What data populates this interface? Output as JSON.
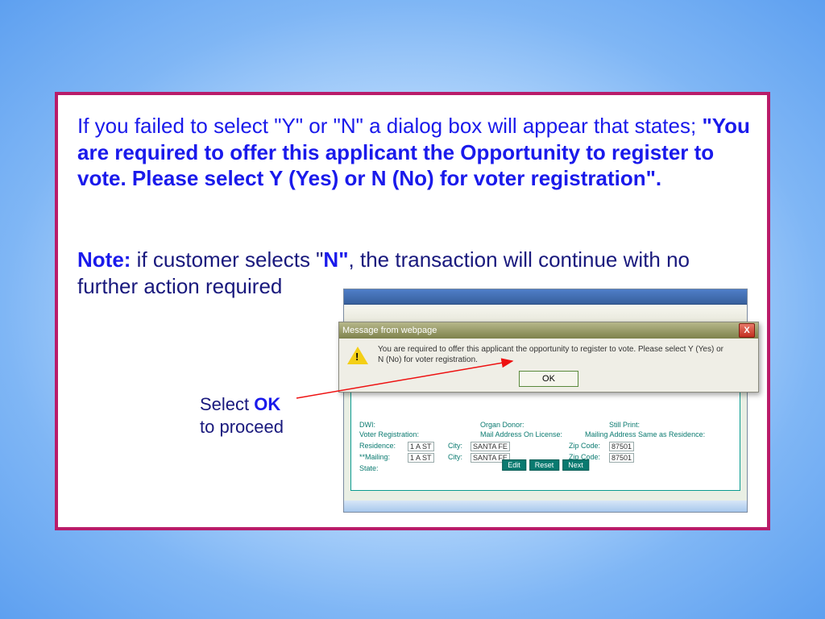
{
  "instruction": {
    "pre": "If you failed to select \"Y\" or \"N\" a dialog box will appear that states; ",
    "bold": "\"You are required to offer this applicant the Opportunity to register to vote.  Please select Y (Yes) or N (No) for voter registration\"."
  },
  "note": {
    "label": "Note:",
    "mid1": " if customer selects \"",
    "n": "N\"",
    "mid2": ", the transaction will continue with no further action required"
  },
  "hint": {
    "pre": "Select ",
    "ok": "OK",
    "post": "to proceed"
  },
  "dialog": {
    "title": "Message from webpage",
    "message": "You are required to offer this applicant the opportunity to register to vote. Please select Y (Yes) or N (No) for voter registration.",
    "ok_label": "OK",
    "close_glyph": "X"
  },
  "mock": {
    "labels": {
      "dwi": "DWI:",
      "voter": "Voter Registration:",
      "residence": "Residence:",
      "mailing": "**Mailing:",
      "organ": "Organ Donor:",
      "mail_lic": "Mail Address On License:",
      "mail_same": "Mailing Address Same as Residence:",
      "still_print": "Still Print:",
      "city": "City:",
      "zip": "Zip Code:",
      "state": "State:"
    },
    "values": {
      "residence_street": "1 A ST",
      "mailing_street": "1 A ST",
      "city": "SANTA FE",
      "zip": "87501"
    },
    "buttons": {
      "edit": "Edit",
      "reset": "Reset",
      "next": "Next"
    }
  }
}
